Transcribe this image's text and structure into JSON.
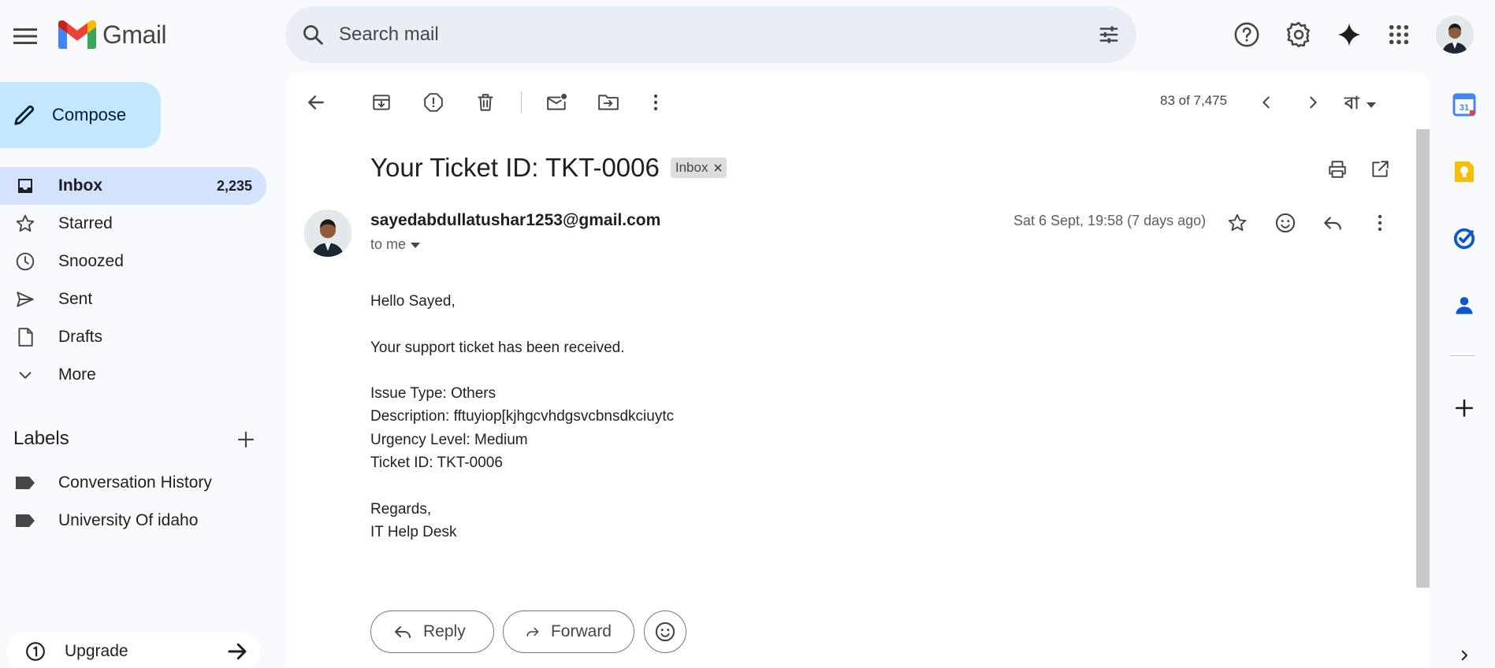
{
  "app": {
    "name": "Gmail"
  },
  "search": {
    "placeholder": "Search mail"
  },
  "compose": {
    "label": "Compose"
  },
  "nav": {
    "items": [
      {
        "label": "Inbox",
        "count": "2,235",
        "icon": "inbox-icon"
      },
      {
        "label": "Starred",
        "icon": "star-icon"
      },
      {
        "label": "Snoozed",
        "icon": "clock-icon"
      },
      {
        "label": "Sent",
        "icon": "send-icon"
      },
      {
        "label": "Drafts",
        "icon": "draft-icon"
      },
      {
        "label": "More",
        "icon": "chevron-down-icon"
      }
    ]
  },
  "labels": {
    "title": "Labels",
    "items": [
      {
        "label": "Conversation History"
      },
      {
        "label": "University Of idaho"
      }
    ]
  },
  "upgrade": {
    "label": "Upgrade"
  },
  "toolbar": {
    "pager": "83 of 7,475",
    "input_tool": "বা"
  },
  "email": {
    "subject": "Your Ticket ID: TKT-0006",
    "label_chip": "Inbox",
    "sender": "sayedabdullatushar1253@gmail.com",
    "recipient": "to me",
    "date": "Sat 6 Sept, 19:58 (7 days ago)",
    "body": {
      "greeting": "Hello Sayed,",
      "intro": "Your support ticket has been received.",
      "issue_type": "Issue Type: Others",
      "description": "Description: fftuyiop[kjhgcvhdgsvcbnsdkciuytc",
      "urgency": "Urgency Level: Medium",
      "ticket_id": "Ticket ID: TKT-0006",
      "closing": "Regards,",
      "signature": "IT Help Desk"
    }
  },
  "actions": {
    "reply": "Reply",
    "forward": "Forward"
  },
  "side_panel": {
    "calendar_day": "31"
  },
  "colors": {
    "accent": "#0b57d0",
    "compose_bg": "#c2e7ff",
    "active_nav": "#d3e3fd",
    "search_bg": "#e9eef6"
  }
}
